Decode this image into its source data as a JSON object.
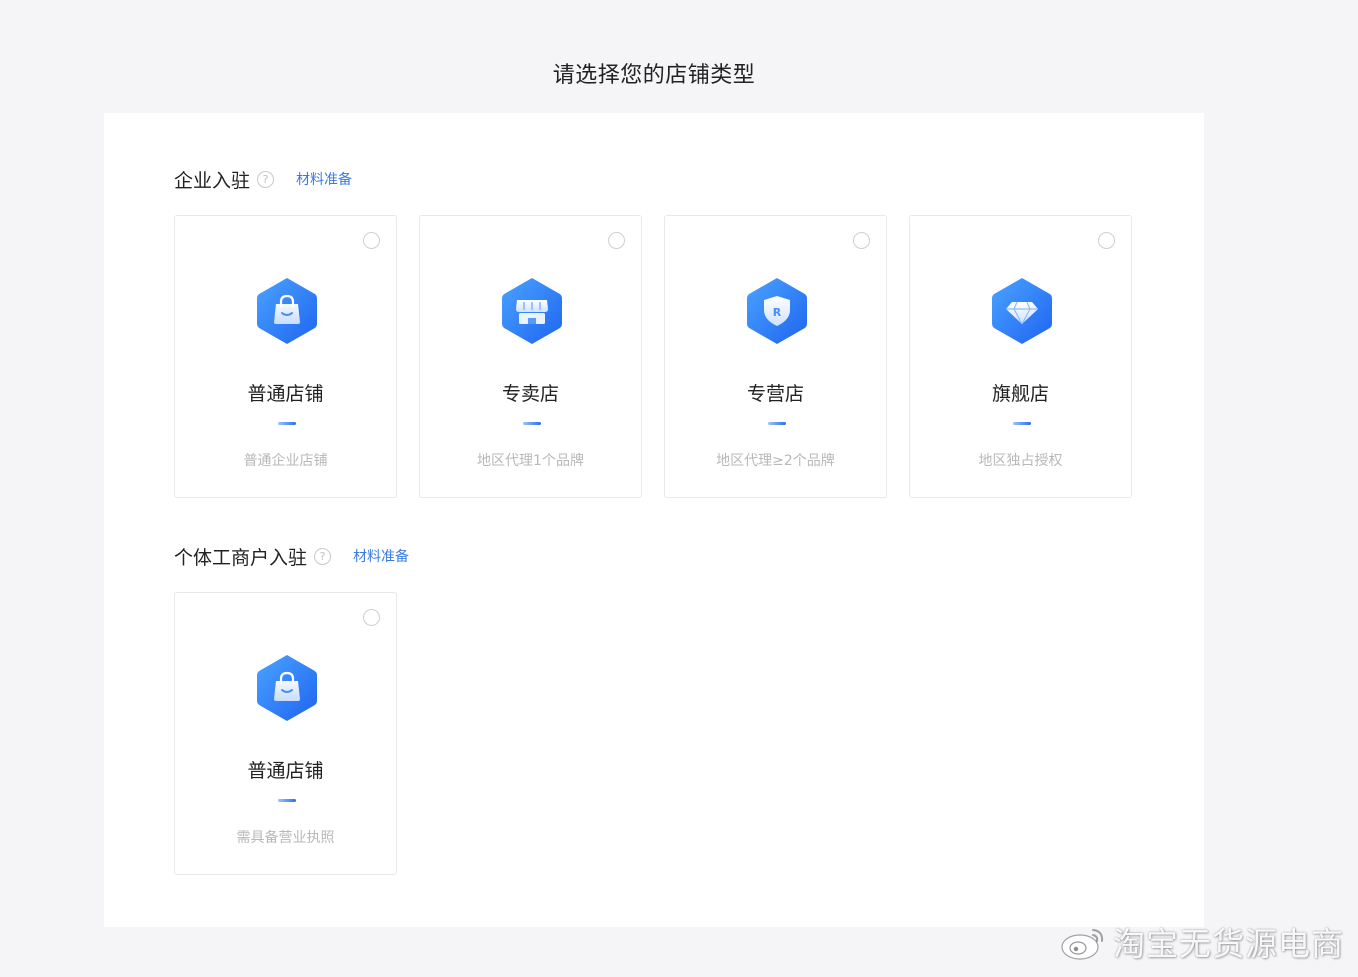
{
  "page": {
    "title": "请选择您的店铺类型"
  },
  "enterprise": {
    "title": "企业入驻",
    "help": "?",
    "link": "材料准备",
    "cards": [
      {
        "title": "普通店铺",
        "desc": "普通企业店铺",
        "icon": "shopping-bag-icon"
      },
      {
        "title": "专卖店",
        "desc": "地区代理1个品牌",
        "icon": "storefront-icon"
      },
      {
        "title": "专营店",
        "desc": "地区代理≥2个品牌",
        "icon": "shield-r-icon"
      },
      {
        "title": "旗舰店",
        "desc": "地区独占授权",
        "icon": "diamond-icon"
      }
    ]
  },
  "individual": {
    "title": "个体工商户入驻",
    "help": "?",
    "link": "材料准备",
    "cards": [
      {
        "title": "普通店铺",
        "desc": "需具备营业执照",
        "icon": "shopping-bag-icon"
      }
    ]
  },
  "watermark": {
    "text": "淘宝无货源电商"
  },
  "colors": {
    "accent": "#2a6ff0",
    "link": "#3a7be0",
    "background": "#f5f5f8"
  }
}
